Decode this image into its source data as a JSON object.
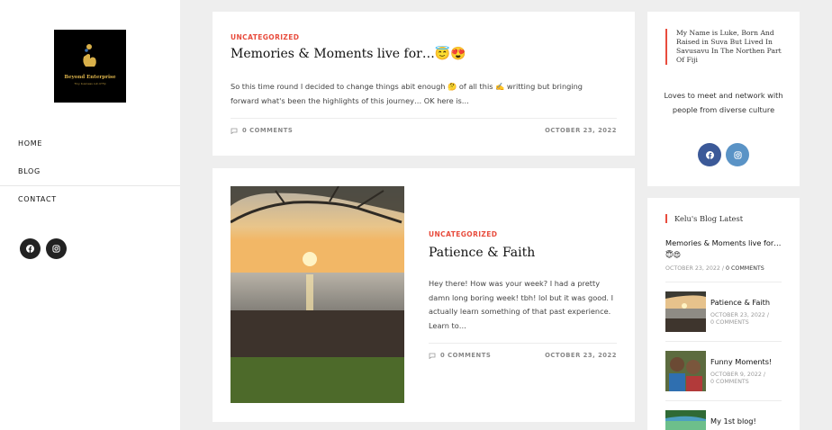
{
  "sidebar": {
    "logo": {
      "name": "Beyond Enterprise",
      "tagline": "Tiny business out of Fiji"
    },
    "nav": [
      "HOME",
      "BLOG",
      "CONTACT"
    ],
    "social": [
      {
        "icon": "facebook-icon"
      },
      {
        "icon": "instagram-icon"
      }
    ]
  },
  "posts": [
    {
      "category": "UNCATEGORIZED",
      "title": "Memories & Moments live for…😇😍",
      "excerpt": "So this time round I decided to change things abit enough 🤔 of all this ✍️ writting but bringing forward what's been the highlights of this journey… OK here is…",
      "comments": "0 COMMENTS",
      "date": "OCTOBER 23, 2022"
    },
    {
      "category": "UNCATEGORIZED",
      "title": "Patience & Faith",
      "excerpt": "Hey there! How was your week? I had a pretty damn long boring week! tbh! lol but it was good. I actually learn something of that past experience. Learn to…",
      "comments": "0 COMMENTS",
      "date": "OCTOBER 23, 2022"
    }
  ],
  "about": {
    "quote": "My Name is Luke, Born And Raised in Suva But Lived In Savusavu In The Northen Part Of Fiji",
    "bio": "Loves to meet and network with people from diverse culture",
    "social": [
      {
        "icon": "facebook-icon",
        "color": "#3b5998"
      },
      {
        "icon": "instagram-icon",
        "color": "#5a93c6"
      }
    ]
  },
  "latest": {
    "title": "Kelu's Blog Latest",
    "items": [
      {
        "title": "Memories & Moments live for…😇😍",
        "date": "OCTOBER 23, 2022",
        "comments": "0 COMMENTS"
      },
      {
        "title": "Patience & Faith",
        "date": "OCTOBER 23, 2022",
        "comments": "0 COMMENTS"
      },
      {
        "title": "Funny Moments!",
        "date": "OCTOBER 9, 2022",
        "comments": "0 COMMENTS"
      },
      {
        "title": "My 1st blog!"
      }
    ]
  },
  "colors": {
    "accent": "#e84c3d",
    "background": "#eeeeee",
    "card": "#ffffff",
    "dark": "#222222"
  }
}
